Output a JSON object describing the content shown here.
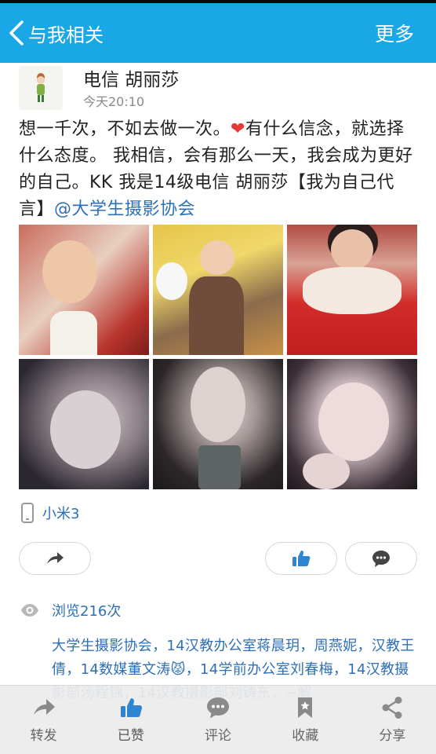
{
  "header": {
    "back_label": "与我相关",
    "more_label": "更多"
  },
  "post": {
    "author": "电信 胡丽莎",
    "time": "今天20:10",
    "text_before_heart": "想一千次，不如去做一次。",
    "text_after_heart": "有什么信念，就选择什么态度。 我相信，会有那么一天，我会成为更好的自己。KK 我是14级电信 胡丽莎【我为自己代言】",
    "mention": "@大学生摄影协会",
    "device": "小米3",
    "views": "浏览216次"
  },
  "photos": [
    {
      "name": "photo-1"
    },
    {
      "name": "photo-2"
    },
    {
      "name": "photo-3"
    },
    {
      "name": "photo-4"
    },
    {
      "name": "photo-5"
    },
    {
      "name": "photo-6"
    }
  ],
  "likers_text": "大学生摄影协会，14汉教办公室蒋晨玥，周燕妮，汉教王倩，14数媒董文涛",
  "likers_text_2": "，14学前办公室刘春梅，14汉教摄影部汤程锦，14汉教摄影部刘铸东，~解",
  "tabs": [
    {
      "label": "转发",
      "icon": "share-arrow-icon"
    },
    {
      "label": "已赞",
      "icon": "thumbs-up-icon"
    },
    {
      "label": "评论",
      "icon": "comment-icon"
    },
    {
      "label": "收藏",
      "icon": "bookmark-icon"
    },
    {
      "label": "分享",
      "icon": "share-icon"
    }
  ],
  "colors": {
    "accent": "#1aa7e6",
    "link": "#2e6fb6",
    "heart": "#e53935"
  }
}
